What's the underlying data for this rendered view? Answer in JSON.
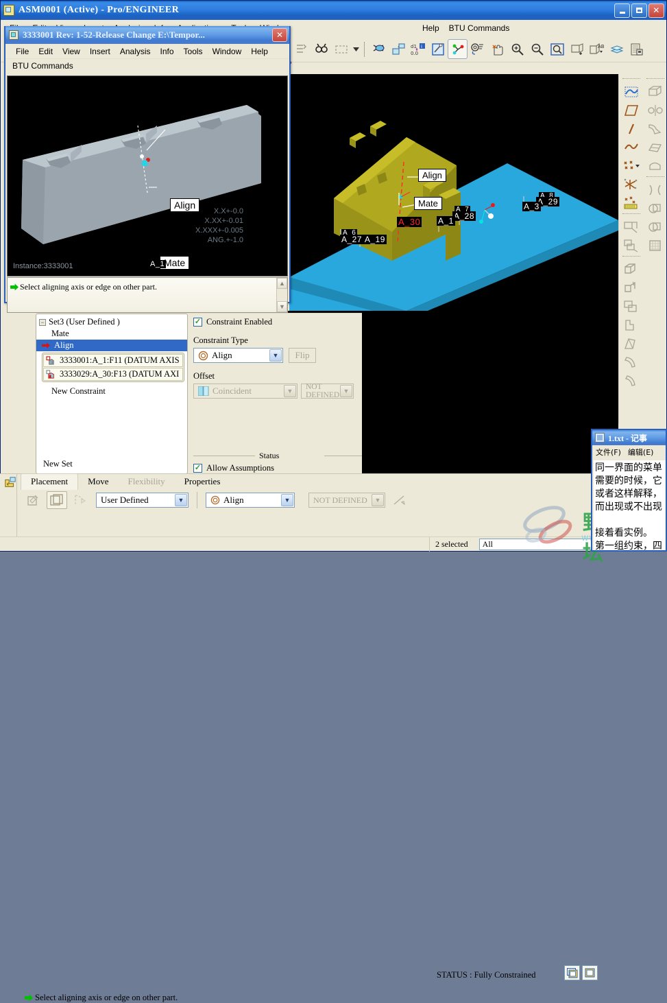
{
  "main_window": {
    "title": "ASM0001 (Active) - Pro/ENGINEER",
    "icon": "application-icon",
    "buttons": {
      "minimize": "minimize-button",
      "maximize": "maximize-button",
      "close": "close-button"
    },
    "menus": [
      "File",
      "Edit",
      "View",
      "Insert",
      "Analysis",
      "Info",
      "Applications",
      "Tools",
      "Window",
      "Help"
    ],
    "menu_visible_right": [
      "Help",
      "BTU Commands"
    ],
    "help_label": "Help",
    "btu_label": "BTU Commands",
    "question_mark": "?"
  },
  "child_window": {
    "title": "3333001 Rev: 1-52-Release Change E:\\Tempor...",
    "close_label": "✕",
    "menus": [
      "File",
      "Edit",
      "View",
      "Insert",
      "Analysis",
      "Info",
      "Tools",
      "Window",
      "Help"
    ],
    "btu_label": "BTU Commands",
    "message": "Select aligning axis or edge on other part.",
    "viewport": {
      "instance_label": "Instance:3333001",
      "tolerances": [
        "X.X+-0.0",
        "X.XX+-0.01",
        "X.XXX+-0.005",
        "ANG.+-1.0"
      ],
      "callouts": [
        "Align",
        "Mate"
      ],
      "axis_tag": "A_1"
    }
  },
  "main_viewport": {
    "callouts": [
      "Align",
      "Mate"
    ],
    "axis_labels": [
      {
        "text": "A_30",
        "color": "#ff2a2a"
      },
      {
        "text": "A_27",
        "color": "#ffffff"
      },
      {
        "text": "A_19",
        "color": "#ffffff"
      },
      {
        "text": "A_6",
        "color": "#ffffff"
      },
      {
        "text": "A_28",
        "color": "#ffffff"
      },
      {
        "text": "A_7",
        "color": "#ffffff"
      },
      {
        "text": "A_1",
        "color": "#ffffff"
      },
      {
        "text": "A_29",
        "color": "#ffffff"
      },
      {
        "text": "A_8",
        "color": "#ffffff"
      },
      {
        "text": "A_3",
        "color": "#ffffff"
      }
    ],
    "part_colors": {
      "moving_part": "#b0a81e",
      "base_plate": "#29a8dd",
      "background": "#000000"
    }
  },
  "constraint_dialog": {
    "tree": {
      "set_label": "Set3 (User Defined )",
      "items": [
        {
          "label": "Mate",
          "type": "constraint",
          "selected": false
        },
        {
          "label": "Align",
          "type": "constraint",
          "selected": true
        }
      ],
      "references": [
        "3333001:A_1:F11 (DATUM AXIS",
        "3333029:A_30:F13 (DATUM AXI"
      ],
      "new_constraint_label": "New Constraint",
      "new_set_label": "New Set"
    },
    "enabled_checkbox": {
      "label": "Constraint Enabled",
      "checked": true
    },
    "constraint_type": {
      "label": "Constraint Type",
      "value": "Align",
      "flip_button": "Flip",
      "flip_disabled": true
    },
    "offset": {
      "label": "Offset",
      "value": "Coincident",
      "secondary_value": "NOT DEFINED",
      "disabled": true
    },
    "status_group": {
      "caption": "Status",
      "allow_assumptions": {
        "label": "Allow Assumptions",
        "checked": true
      },
      "state": "Fully Constrained"
    }
  },
  "placement_panel": {
    "tabs": [
      {
        "label": "Placement",
        "active": true,
        "disabled": false
      },
      {
        "label": "Move",
        "active": false,
        "disabled": false
      },
      {
        "label": "Flexibility",
        "active": false,
        "disabled": true
      },
      {
        "label": "Properties",
        "active": false,
        "disabled": false
      }
    ],
    "set_type_combo": "User Defined",
    "constraint_combo": "Align",
    "offset_combo": "NOT DEFINED",
    "status_label": "STATUS : Fully Constrained",
    "message": "Select aligning axis or edge on other part.",
    "icons": [
      "define-constraint-icon",
      "copy-placement-icon",
      "move-datum-icon",
      "measure-icon"
    ]
  },
  "statusbar": {
    "selected_count": "2 selected",
    "filter_value": "All"
  },
  "notepad": {
    "title": "1.txt - 记事",
    "menus": [
      "文件(F)",
      "编辑(E)"
    ],
    "lines": [
      "同一界面的菜单",
      "需要的时候，它",
      "或者这样解释，",
      "而出现或不出现",
      "",
      "接着看实例。",
      "第一组约束，四"
    ]
  },
  "watermark": {
    "text": "野火论坛",
    "url": "www.proewildfire.cn"
  },
  "colors": {
    "title_blue": "#2f7fe0",
    "window_face": "#ece9d8",
    "accent_select": "#3169c6",
    "part_yellow": "#b0a81e",
    "plate_blue": "#29a8dd",
    "red_axis": "#ff2a2a",
    "green_check": "#2aa02a"
  }
}
